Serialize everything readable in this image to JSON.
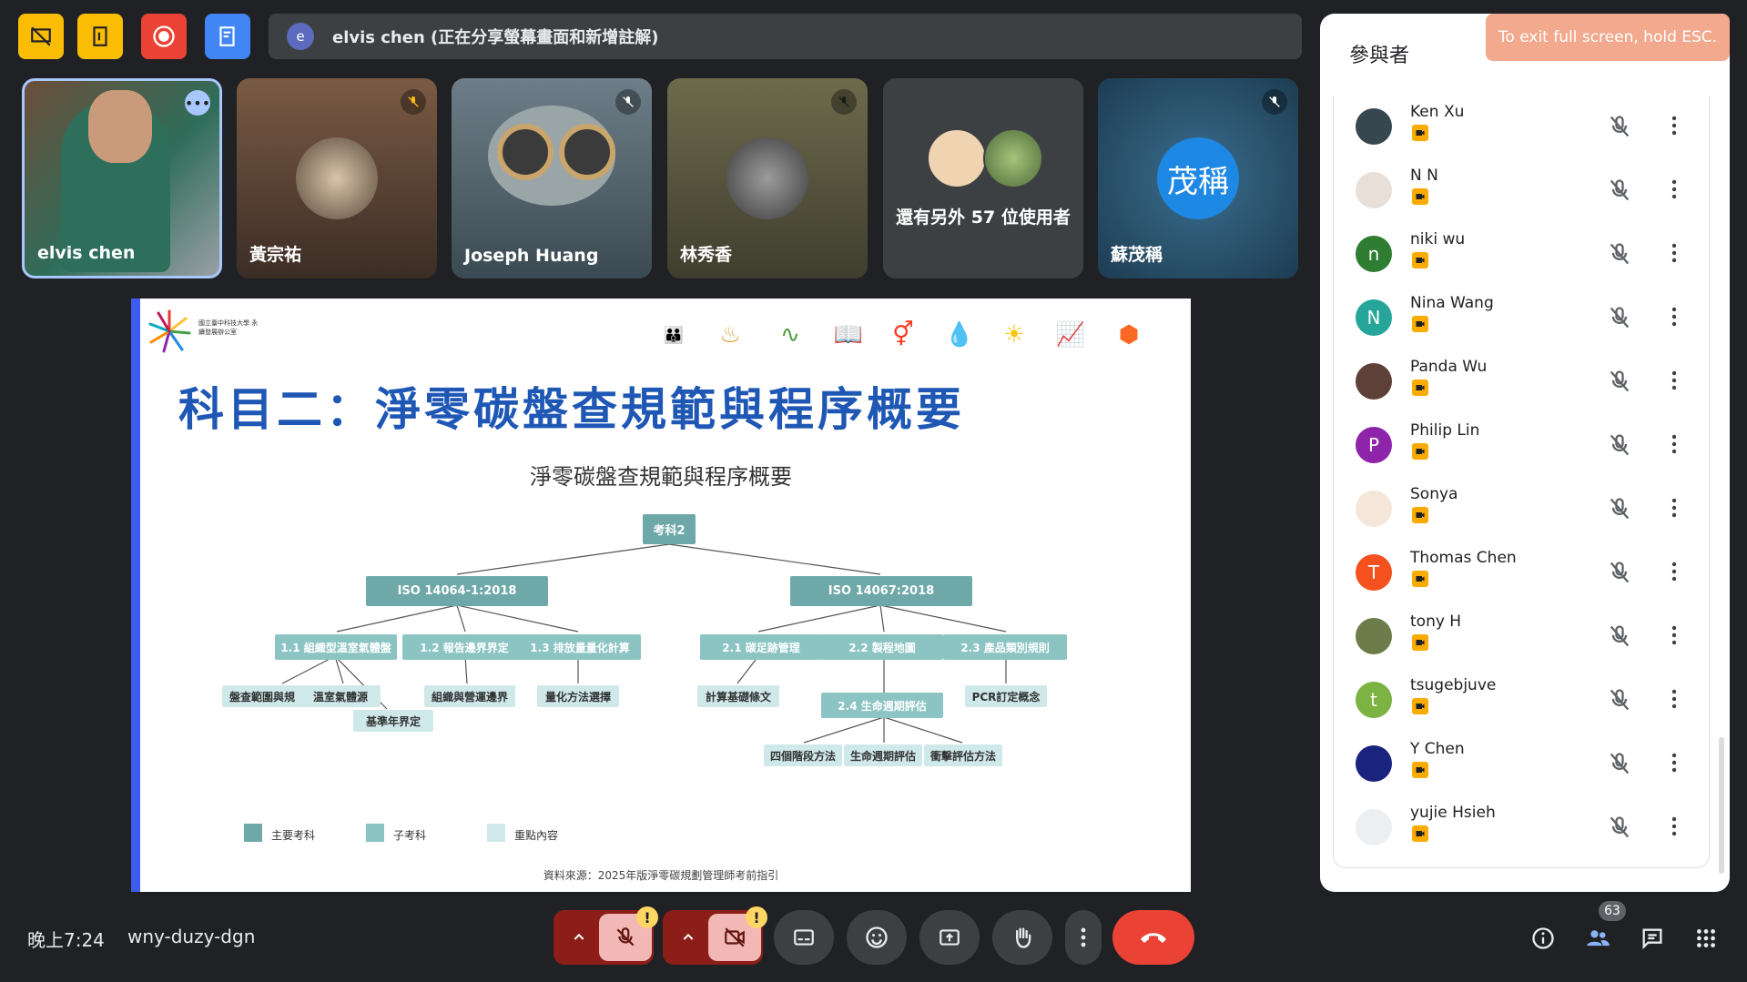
{
  "presenter_banner": {
    "initial": "e",
    "text": "elvis chen (正在分享螢幕畫面和新增註解)"
  },
  "tiles": [
    {
      "name": "elvis chen"
    },
    {
      "name": "黃宗祐"
    },
    {
      "name": "Joseph Huang"
    },
    {
      "name": "林秀香"
    },
    {
      "name": "還有另外 57 位使用者"
    },
    {
      "name": "蘇茂稱",
      "avatar_text": "茂稱"
    }
  ],
  "slide": {
    "logo_text": "國立臺中科技大學 永續發展辦公室",
    "title": "科目二：淨零碳盤查規範與程序概要",
    "subtitle": "淨零碳盤查規範與程序概要",
    "root": "考科2",
    "main": [
      "ISO 14064-1:2018",
      "ISO 14067:2018"
    ],
    "sub": [
      "1.1 組織型溫室氣體盤",
      "1.2 報告邊界界定",
      "1.3 排放量量化計算",
      "2.1 碳足跡管理",
      "2.2 製程地圖",
      "2.3 產品類別規則",
      "2.4 生命週期評估"
    ],
    "key": [
      "盤查範圍與規",
      "溫室氣體源",
      "基準年界定",
      "組織與營運邊界",
      "量化方法選擇",
      "計算基礎條文",
      "PCR訂定概念",
      "四個階段方法",
      "生命週期評估",
      "衝擊評估方法"
    ],
    "legend": [
      "主要考科",
      "子考科",
      "重點內容"
    ],
    "source": "資料來源：2025年版淨零碳規劃管理師考前指引"
  },
  "panel": {
    "title": "參與者",
    "toast": "To exit full screen, hold ESC.",
    "participants": [
      {
        "name": "Ken Xu",
        "initial": "",
        "color": "#37474f"
      },
      {
        "name": "N N",
        "initial": "",
        "color": "#e8e0d8"
      },
      {
        "name": "niki wu",
        "initial": "n",
        "color": "#2e7d32"
      },
      {
        "name": "Nina Wang",
        "initial": "N",
        "color": "#26a69a"
      },
      {
        "name": "Panda Wu",
        "initial": "",
        "color": "#5d4037"
      },
      {
        "name": "Philip Lin",
        "initial": "P",
        "color": "#8e24aa"
      },
      {
        "name": "Sonya",
        "initial": "",
        "color": "#f5e6da"
      },
      {
        "name": "Thomas Chen",
        "initial": "T",
        "color": "#f4511e"
      },
      {
        "name": "tony H",
        "initial": "",
        "color": "#6d7c4b"
      },
      {
        "name": "tsugebjuve",
        "initial": "t",
        "color": "#7cb342"
      },
      {
        "name": "Y Chen",
        "initial": "",
        "color": "#1a237e"
      },
      {
        "name": "yujie Hsieh",
        "initial": "",
        "color": "#eceff1"
      }
    ]
  },
  "bottom": {
    "time": "晚上7:24",
    "code": "wny-duzy-dgn",
    "participant_count": "63"
  }
}
